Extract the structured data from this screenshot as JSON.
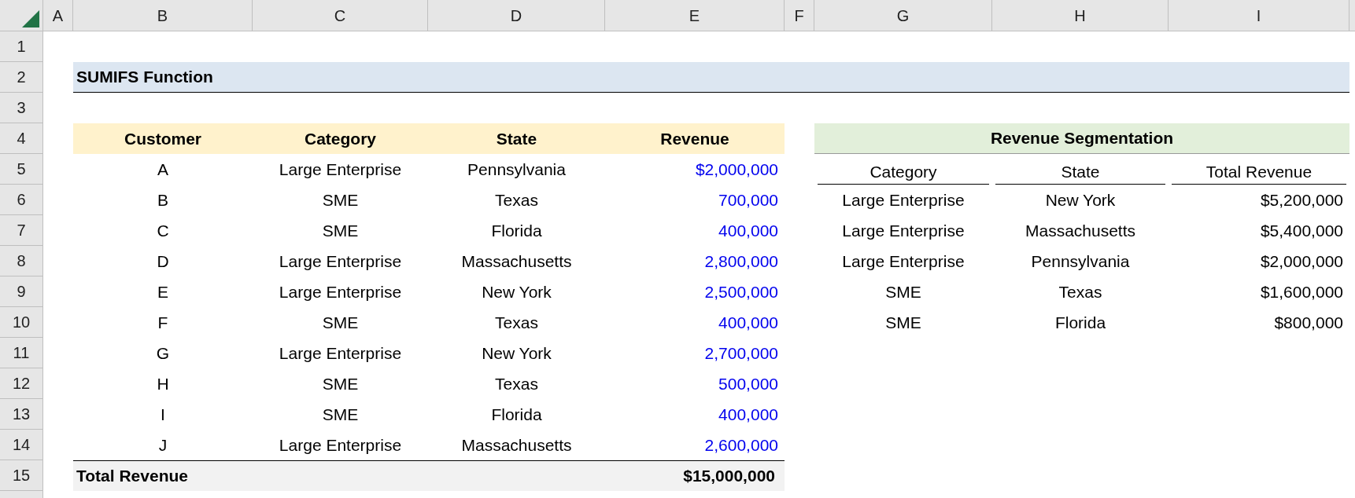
{
  "columns": [
    "A",
    "B",
    "C",
    "D",
    "E",
    "F",
    "G",
    "H",
    "I"
  ],
  "row_numbers": [
    "1",
    "2",
    "3",
    "4",
    "5",
    "6",
    "7",
    "8",
    "9",
    "10",
    "11",
    "12",
    "13",
    "14",
    "15"
  ],
  "title": "SUMIFS Function",
  "data_table": {
    "columns": [
      "Customer",
      "Category",
      "State",
      "Revenue"
    ],
    "rows": [
      [
        "A",
        "Large Enterprise",
        "Pennsylvania",
        "$2,000,000"
      ],
      [
        "B",
        "SME",
        "Texas",
        "700,000"
      ],
      [
        "C",
        "SME",
        "Florida",
        "400,000"
      ],
      [
        "D",
        "Large Enterprise",
        "Massachusetts",
        "2,800,000"
      ],
      [
        "E",
        "Large Enterprise",
        "New York",
        "2,500,000"
      ],
      [
        "F",
        "SME",
        "Texas",
        "400,000"
      ],
      [
        "G",
        "Large Enterprise",
        "New York",
        "2,700,000"
      ],
      [
        "H",
        "SME",
        "Texas",
        "500,000"
      ],
      [
        "I",
        "SME",
        "Florida",
        "400,000"
      ],
      [
        "J",
        "Large Enterprise",
        "Massachusetts",
        "2,600,000"
      ]
    ],
    "total": {
      "label": "Total Revenue",
      "value": "$15,000,000"
    }
  },
  "segmentation": {
    "title": "Revenue Segmentation",
    "columns": [
      "Category",
      "State",
      "Total Revenue"
    ],
    "rows": [
      [
        "Large Enterprise",
        "New York",
        "$5,200,000"
      ],
      [
        "Large Enterprise",
        "Massachusetts",
        "$5,400,000"
      ],
      [
        "Large Enterprise",
        "Pennsylvania",
        "$2,000,000"
      ],
      [
        "SME",
        "Texas",
        "$1,600,000"
      ],
      [
        "SME",
        "Florida",
        "$800,000"
      ]
    ]
  }
}
